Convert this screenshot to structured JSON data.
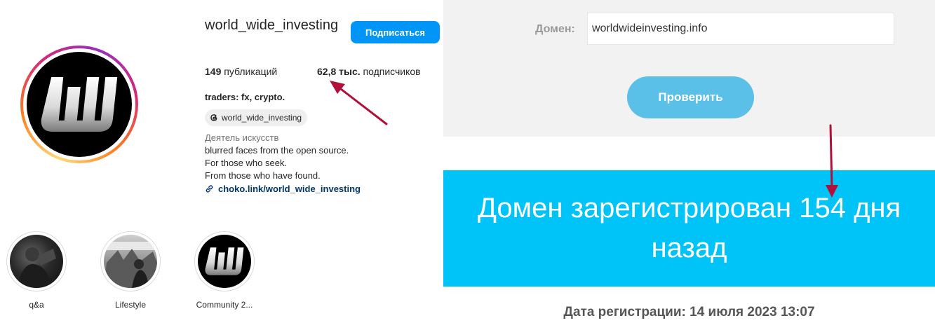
{
  "profile": {
    "username": "world_wide_investing",
    "follow_label": "Подписаться",
    "posts_count": "149",
    "posts_label": "публикаций",
    "followers_count": "62,8 тыс.",
    "followers_label": "подписчиков",
    "bio_name": "traders: fx, crypto.",
    "threads_handle": "world_wide_investing",
    "category": "Деятель искусств",
    "bio_lines": [
      "blurred faces from the open source.",
      "For those who seek.",
      "From those who have found."
    ],
    "link": "choko.link/world_wide_investing",
    "avatar_letter": "W",
    "highlights": [
      {
        "caption": "q&a"
      },
      {
        "caption": "Lifestyle"
      },
      {
        "caption": "Community 2..."
      }
    ]
  },
  "checker": {
    "domain_label": "Домен:",
    "domain_value": "worldwideinvesting.info",
    "check_label": "Проверить",
    "result": "Домен зарегистрирован 154 дня назад",
    "registration_date": "Дата регистрации: 14 июля 2023 13:07"
  },
  "colors": {
    "follow_button": "#0095f6",
    "check_button": "#5bc0e7",
    "result_band": "#00c3f8",
    "annotation_arrow": "#b0103a"
  }
}
